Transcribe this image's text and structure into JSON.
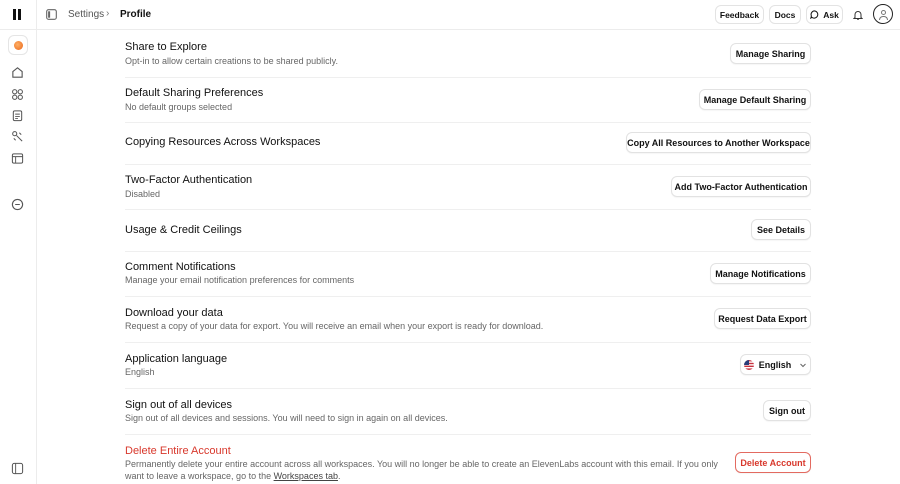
{
  "breadcrumb": {
    "parent": "Settings",
    "current": "Profile"
  },
  "topbar": {
    "feedback": "Feedback",
    "docs": "Docs",
    "ask": "Ask"
  },
  "icons": {
    "logo": "elevenlabs-logo-icon",
    "sidebar_toggle": "sidebar-toggle-icon",
    "chevron": "chevron-right-icon",
    "ask": "chat-bubble-icon",
    "bell": "bell-icon",
    "avatar": "user-avatar-icon",
    "sidebar": [
      "home-icon",
      "grid-icon",
      "clipboard-icon",
      "tools-icon",
      "layout-icon",
      "chat-circle-icon",
      "panel-icon"
    ]
  },
  "rows": {
    "share_explore": {
      "title": "Share to Explore",
      "desc": "Opt-in to allow certain creations to be shared publicly.",
      "button": "Manage Sharing"
    },
    "default_sharing": {
      "title": "Default Sharing Preferences",
      "desc": "No default groups selected",
      "button": "Manage Default Sharing"
    },
    "copy_resources": {
      "title": "Copying Resources Across Workspaces",
      "button": "Copy All Resources to Another Workspace"
    },
    "two_factor": {
      "title": "Two-Factor Authentication",
      "desc": "Disabled",
      "button": "Add Two-Factor Authentication"
    },
    "usage": {
      "title": "Usage & Credit Ceilings",
      "button": "See Details"
    },
    "comment_notifications": {
      "title": "Comment Notifications",
      "desc": "Manage your email notification preferences for comments",
      "button": "Manage Notifications"
    },
    "download": {
      "title": "Download your data",
      "desc": "Request a copy of your data for export. You will receive an email when your export is ready for download.",
      "button": "Request Data Export"
    },
    "language": {
      "title": "Application language",
      "desc": "English",
      "button": "English",
      "chevron": "chevron-down-icon",
      "flag": "us-flag-icon"
    },
    "sign_out": {
      "title": "Sign out of all devices",
      "desc": "Sign out of all devices and sessions. You will need to sign in again on all devices.",
      "button": "Sign out"
    },
    "delete": {
      "title": "Delete Entire Account",
      "desc_line1": "Permanently delete your entire account across all workspaces. You will no longer be able to create an ElevenLabs account with this email. If you only",
      "desc_line2_prefix": "want to leave a workspace, go to the ",
      "desc_link": "Workspaces tab",
      "desc_suffix": ".",
      "button": "Delete Account"
    }
  },
  "colors": {
    "danger": "#d8382c",
    "border": "#e2e2e2",
    "muted": "#666666"
  }
}
